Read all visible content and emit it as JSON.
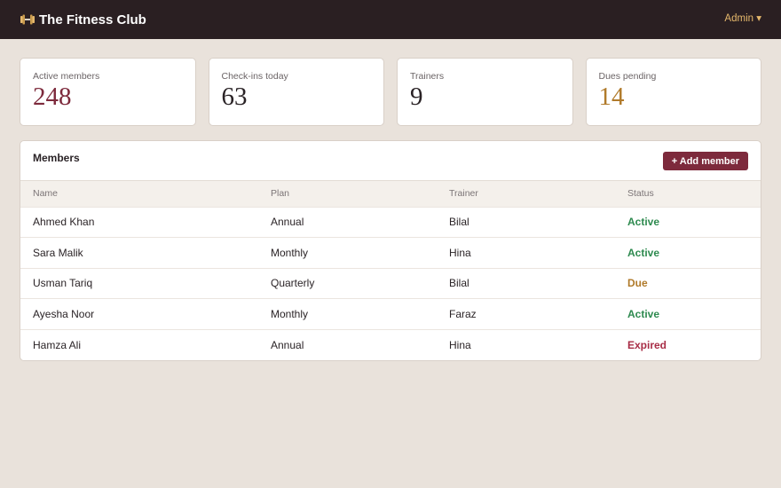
{
  "header": {
    "title": "The Fitness Club",
    "logo_icon": "dumbbell-icon",
    "admin_label": "Admin ▾"
  },
  "stats": [
    {
      "label": "Active members",
      "value": "248",
      "color": "#7d2a3c"
    },
    {
      "label": "Check-ins today",
      "value": "63",
      "color": "#2a2326"
    },
    {
      "label": "Trainers",
      "value": "9",
      "color": "#2a2326"
    },
    {
      "label": "Dues pending",
      "value": "14",
      "color": "#b07a2a"
    }
  ],
  "members": {
    "title": "Members",
    "add_button": "+ Add member",
    "columns": [
      "Name",
      "Plan",
      "Trainer",
      "Status"
    ],
    "rows": [
      {
        "name": "Ahmed Khan",
        "plan": "Annual",
        "trainer": "Bilal",
        "status": "Active",
        "status_color": "#2e8a4f"
      },
      {
        "name": "Sara Malik",
        "plan": "Monthly",
        "trainer": "Hina",
        "status": "Active",
        "status_color": "#2e8a4f"
      },
      {
        "name": "Usman Tariq",
        "plan": "Quarterly",
        "trainer": "Bilal",
        "status": "Due",
        "status_color": "#b07a2a"
      },
      {
        "name": "Ayesha Noor",
        "plan": "Monthly",
        "trainer": "Faraz",
        "status": "Active",
        "status_color": "#2e8a4f"
      },
      {
        "name": "Hamza Ali",
        "plan": "Annual",
        "trainer": "Hina",
        "status": "Expired",
        "status_color": "#a82d46"
      }
    ]
  },
  "colors": {
    "topbar": "#2a1f22",
    "accent": "#7d2a3c",
    "background": "#e9e2db"
  }
}
